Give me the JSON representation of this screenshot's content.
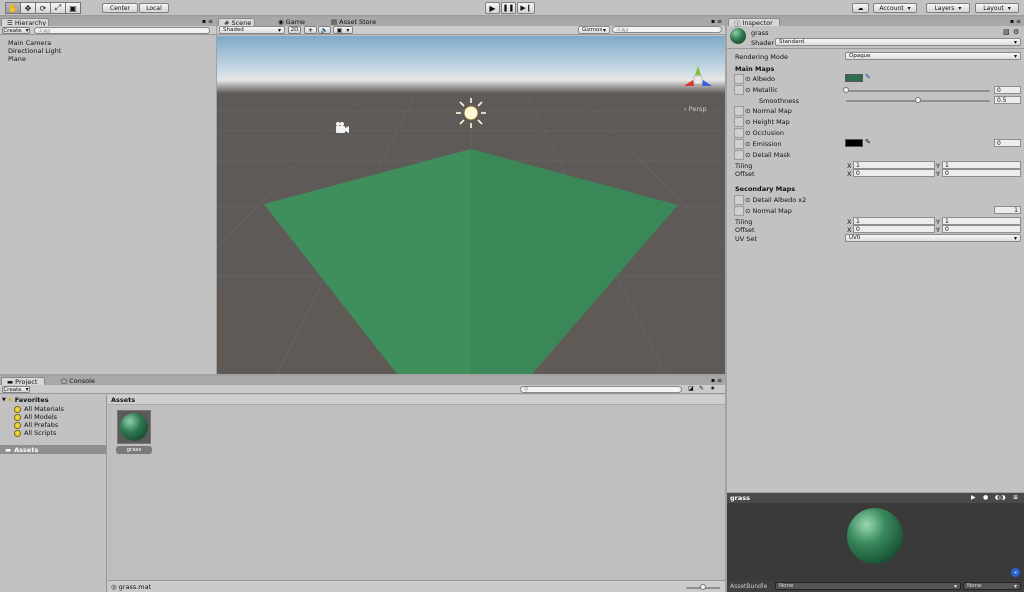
{
  "toolbar": {
    "center_label": "Center",
    "local_label": "Local",
    "account_label": "Account",
    "layers_label": "Layers",
    "layout_label": "Layout"
  },
  "hierarchy": {
    "tab": "Hierarchy",
    "create_label": "Create",
    "search_placeholder": "ⒶAll",
    "items": [
      "Main Camera",
      "Directional Light",
      "Plane"
    ]
  },
  "scene": {
    "tabs": [
      "Scene",
      "Game",
      "Asset Store"
    ],
    "shading_mode": "Shaded",
    "mode_2d": "2D",
    "gizmos_label": "Gizmos",
    "search_placeholder": "ⒶAll",
    "persp_label": "‹ Persp",
    "colors": {
      "ground": "#5e5a58",
      "sky": "#9fbfd6",
      "plane": "#3f8f5c"
    }
  },
  "project": {
    "tabs": [
      "Project",
      "Console"
    ],
    "create_label": "Create",
    "favorites_label": "Favorites",
    "favorites": [
      "All Materials",
      "All Models",
      "All Prefabs",
      "All Scripts"
    ],
    "assets_root": "Assets",
    "breadcrumb": "Assets",
    "asset_items": [
      {
        "name": "grass"
      }
    ],
    "status_file": "grass.mat"
  },
  "inspector": {
    "tab": "Inspector",
    "material_name": "grass",
    "shader_label": "Shader",
    "shader_value": "Standard",
    "rendering_mode_label": "Rendering Mode",
    "rendering_mode_value": "Opaque",
    "main_maps_label": "Main Maps",
    "albedo_label": "⊙ Albedo",
    "metallic_label": "⊙ Metallic",
    "metallic_value": "0",
    "metallic_level": 0.0,
    "smoothness_label": "Smoothness",
    "smoothness_value": "0.5",
    "smoothness_level": 0.5,
    "normal_map_label": "⊙ Normal Map",
    "height_map_label": "⊙ Height Map",
    "occlusion_label": "⊙ Occlusion",
    "emission_label": "⊙ Emission",
    "emission_value": "0",
    "detail_mask_label": "⊙ Detail Mask",
    "tiling_label": "Tiling",
    "offset_label": "Offset",
    "x_label": "X",
    "y_label": "Y",
    "tiling_x": "1",
    "tiling_y": "1",
    "offset_x": "0",
    "offset_y": "0",
    "secondary_maps_label": "Secondary Maps",
    "detail_albedo_label": "⊙ Detail Albedo x2",
    "sec_normal_map_label": "⊙ Normal Map",
    "sec_normal_value": "1",
    "sec_tiling_x": "1",
    "sec_tiling_y": "1",
    "sec_offset_x": "0",
    "sec_offset_y": "0",
    "uv_set_label": "UV Set",
    "uv_set_value": "UV0",
    "colors": {
      "albedo": "#2e6e4c",
      "emission": "#000000"
    }
  },
  "preview": {
    "title": "grass",
    "asset_bundle_label": "AssetBundle",
    "bundle_value": "None",
    "variant_value": "None"
  }
}
